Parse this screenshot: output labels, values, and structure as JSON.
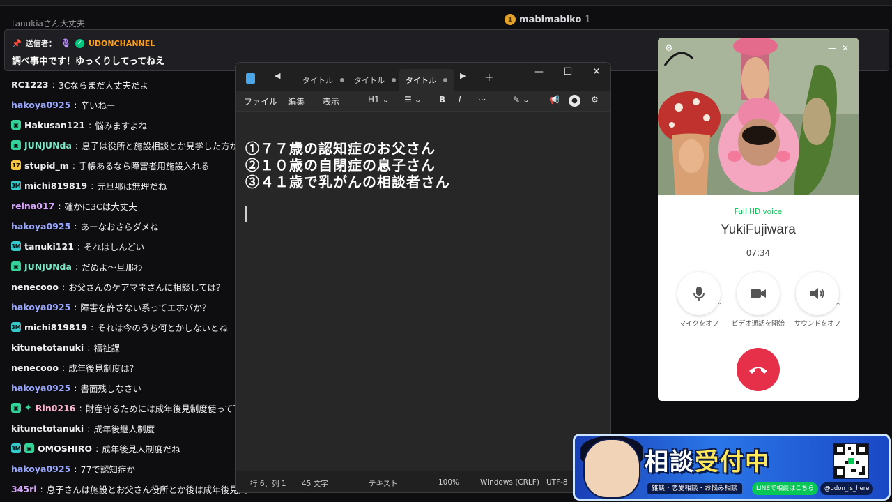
{
  "raid": {
    "name": "mabimabiko",
    "count": "1"
  },
  "pinned": {
    "cut_line": "tanukiaさん大丈夫",
    "sender_label": "送信者：",
    "channel": "UDONCHANNEL",
    "text": "調べ事中です！ゆっくりしてってねえ"
  },
  "chat": [
    {
      "user": "RC1223",
      "color": "#efeff1",
      "badge": "",
      "msg": "3Cならまだ大丈夫だよ"
    },
    {
      "user": "hakoya0925",
      "color": "#9aa8ff",
      "badge": "",
      "msg": "辛いねー"
    },
    {
      "user": "Hakusan121",
      "color": "#efeff1",
      "badge": "gift",
      "msg": "悩みますよね"
    },
    {
      "user": "JUNJUNda",
      "color": "#7ee8c7",
      "badge": "gift",
      "msg": "息子は役所と施設相談とか見学した方が"
    },
    {
      "user": "stupid_m",
      "color": "#efeff1",
      "badge": "yellow",
      "msg": "手帳あるなら障害者用施設入れる"
    },
    {
      "user": "michi819819",
      "color": "#efeff1",
      "badge": "sub",
      "msg": "元旦那は無理だね"
    },
    {
      "user": "reina017",
      "color": "#d9a6ff",
      "badge": "",
      "msg": "確かに3Cは大丈夫"
    },
    {
      "user": "hakoya0925",
      "color": "#9aa8ff",
      "badge": "",
      "msg": "あーなおさらダメね"
    },
    {
      "user": "tanuki121",
      "color": "#efeff1",
      "badge": "sub",
      "msg": "それはしんどい"
    },
    {
      "user": "JUNJUNda",
      "color": "#7ee8c7",
      "badge": "gift",
      "msg": "だめよ〜旦那わ"
    },
    {
      "user": "nenecooo",
      "color": "#efeff1",
      "badge": "",
      "msg": "お父さんのケアマネさんに相談しては？"
    },
    {
      "user": "hakoya0925",
      "color": "#9aa8ff",
      "badge": "",
      "msg": "障害を許さない系ってエホバか？"
    },
    {
      "user": "michi819819",
      "color": "#efeff1",
      "badge": "sub",
      "msg": "それは今のうち何とかしないとね"
    },
    {
      "user": "kitunetotanuki",
      "color": "#efeff1",
      "badge": "",
      "msg": "福祉課"
    },
    {
      "user": "nenecooo",
      "color": "#efeff1",
      "badge": "",
      "msg": "成年後見制度は？"
    },
    {
      "user": "hakoya0925",
      "color": "#9aa8ff",
      "badge": "",
      "msg": "書面残しなさい"
    },
    {
      "user": "Rin0216",
      "color": "#ffb3d1",
      "badge": "gift-star",
      "msg": "財産守るためには成年後見制度使って下"
    },
    {
      "user": "kitunetotanuki",
      "color": "#efeff1",
      "badge": "",
      "msg": "成年後継人制度"
    },
    {
      "user": "OMOSHIRO",
      "color": "#efeff1",
      "badge": "sub-gift",
      "msg": "成年後見人制度だね"
    },
    {
      "user": "hakoya0925",
      "color": "#9aa8ff",
      "badge": "",
      "msg": "77で認知症か"
    },
    {
      "user": "345ri",
      "color": "#d9a6ff",
      "badge": "",
      "msg": "息子さんは施設とお父さん役所とか後は成年後見人"
    }
  ],
  "notepad": {
    "tabs": [
      "タイトル",
      "タイトル",
      "タイトル"
    ],
    "menu": [
      "ファイル",
      "編集",
      "表示"
    ],
    "heading": "H1",
    "lines": [
      "①７７歳の認知症のお父さん",
      "②１０歳の自閉症の息子さん",
      "③４１歳で乳がんの相談者さん"
    ],
    "status": {
      "position": "行 6、列 1",
      "chars": "45 文字",
      "format": "テキスト",
      "zoom": "100%",
      "eol": "Windows (CRLF)",
      "encoding": "UTF-8"
    }
  },
  "call": {
    "voice": "Full HD voice",
    "name": "YukiFujiwara",
    "time": "07:34",
    "buttons": [
      "マイクをオフ",
      "ビデオ通話を開始",
      "サウンドをオフ"
    ]
  },
  "banner": {
    "title_a": "相談",
    "title_b": "受付中",
    "sub": "雑談・恋愛相談・お悩み相談",
    "line": "LINEで相談はこちら",
    "x": "@udon_is_here"
  }
}
